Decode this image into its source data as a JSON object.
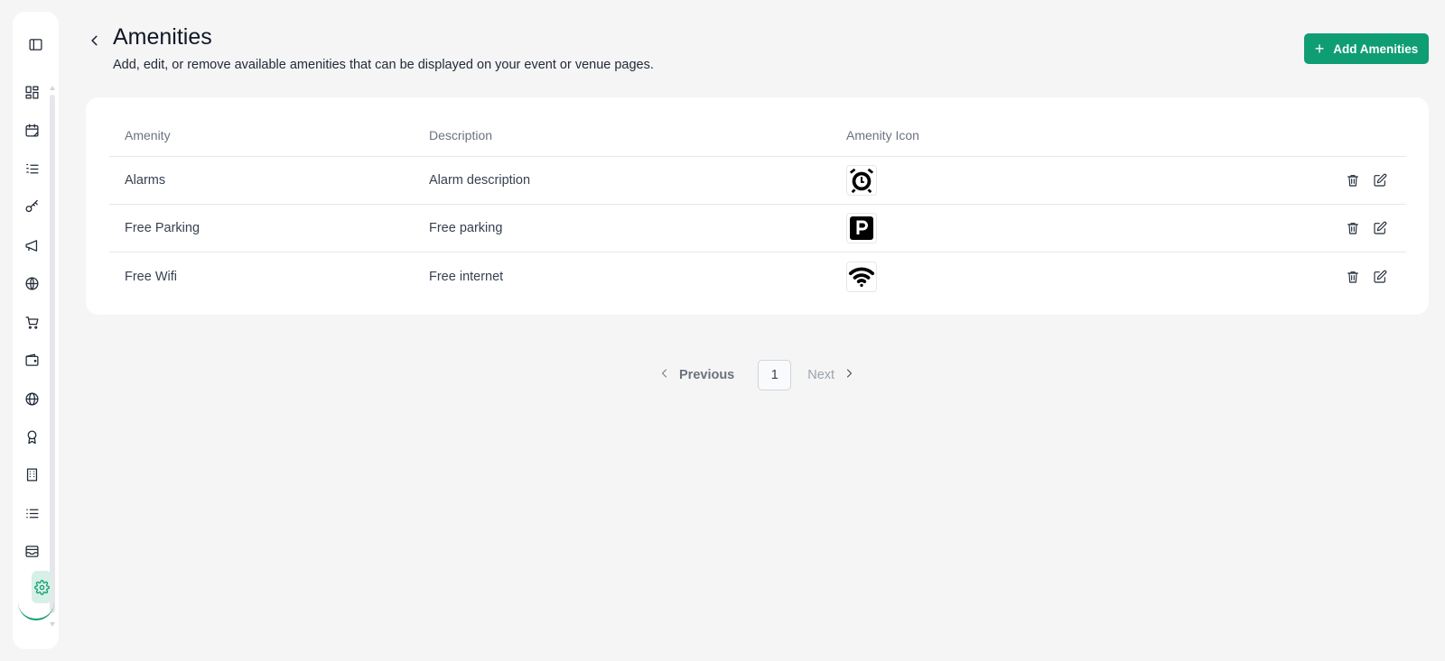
{
  "header": {
    "title": "Amenities",
    "subtitle": "Add, edit, or remove available amenities that can be displayed on your event or venue pages.",
    "add_button_label": "Add Amenities"
  },
  "sidebar": {
    "items": [
      {
        "icon": "dashboard-icon"
      },
      {
        "icon": "calendar-icon"
      },
      {
        "icon": "list-ordered-icon"
      },
      {
        "icon": "key-icon"
      },
      {
        "icon": "megaphone-icon"
      },
      {
        "icon": "globe-grid-icon"
      },
      {
        "icon": "cart-icon"
      },
      {
        "icon": "wallet-icon"
      },
      {
        "icon": "globe-icon"
      },
      {
        "icon": "award-icon"
      },
      {
        "icon": "building-icon"
      },
      {
        "icon": "list-icon"
      },
      {
        "icon": "inbox-icon"
      },
      {
        "icon": "gear-icon",
        "active": true
      }
    ],
    "accent_color": "#0f9d73"
  },
  "table": {
    "columns": [
      "Amenity",
      "Description",
      "Amenity Icon"
    ],
    "rows": [
      {
        "name": "Alarms",
        "description": "Alarm description",
        "icon": "alarm-icon"
      },
      {
        "name": "Free Parking",
        "description": "Free parking",
        "icon": "parking-icon"
      },
      {
        "name": "Free Wifi",
        "description": "Free internet",
        "icon": "wifi-icon"
      }
    ]
  },
  "pagination": {
    "previous_label": "Previous",
    "current_page": "1",
    "next_label": "Next"
  }
}
